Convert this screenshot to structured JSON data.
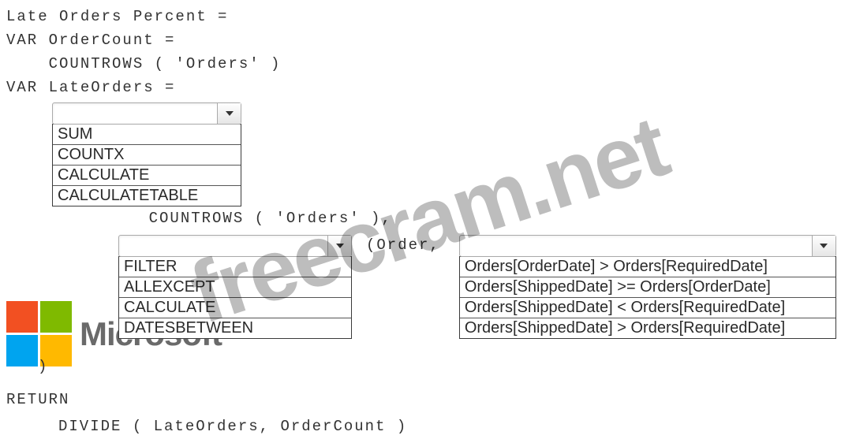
{
  "code": {
    "line1": "Late Orders Percent =",
    "line2": "VAR OrderCount =",
    "line3": "    COUNTROWS ( 'Orders' )",
    "line4": "VAR LateOrders =",
    "line5": "         COUNTROWS ( 'Orders' ),",
    "order_text": " (Order,",
    "close_paren": ")",
    "return": "RETURN",
    "divide": "DIVIDE ( LateOrders, OrderCount )"
  },
  "dropdown1": {
    "selected": "",
    "options": [
      "SUM",
      "COUNTX",
      "CALCULATE",
      "CALCULATETABLE"
    ]
  },
  "dropdown2": {
    "selected": "",
    "options": [
      "FILTER",
      "ALLEXCEPT",
      "CALCULATE",
      "DATESBETWEEN"
    ]
  },
  "dropdown3": {
    "selected": "",
    "options": [
      "Orders[OrderDate] > Orders[RequiredDate]",
      "Orders[ShippedDate] >= Orders[OrderDate]",
      "Orders[ShippedDate] < Orders[RequiredDate]",
      "Orders[ShippedDate] > Orders[RequiredDate]"
    ]
  },
  "logo_text": "Microsoft",
  "watermark": "freecram.net"
}
